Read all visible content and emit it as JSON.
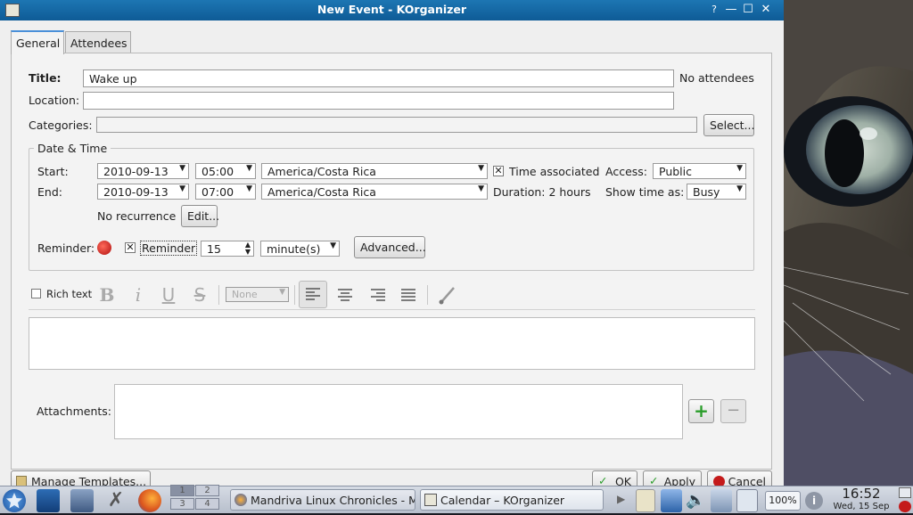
{
  "window": {
    "title": "New Event - KOrganizer",
    "help": "?"
  },
  "tabs": [
    {
      "label": "General"
    },
    {
      "label": "Attendees"
    }
  ],
  "general": {
    "title_label": "Title:",
    "title_value": "Wake up",
    "attendees_note": "No attendees",
    "location_label": "Location:",
    "location_value": "",
    "categories_label": "Categories:",
    "categories_value": "",
    "select_button": "Select...",
    "datetime_group": "Date & Time",
    "start_label": "Start:",
    "start_date": "2010-09-13",
    "start_time": "05:00",
    "start_tz": "America/Costa Rica",
    "time_associated": "Time associated",
    "access_label": "Access:",
    "access_value": "Public",
    "end_label": "End:",
    "end_date": "2010-09-13",
    "end_time": "07:00",
    "end_tz": "America/Costa Rica",
    "duration": "Duration: 2 hours",
    "show_time_label": "Show time as:",
    "show_time_value": "Busy",
    "recurrence": "No recurrence",
    "edit_button": "Edit...",
    "reminder_label": "Reminder:",
    "reminder_check_label": "Reminder",
    "reminder_value": "15",
    "reminder_unit": "minute(s)",
    "advanced_button": "Advanced...",
    "rich_text_label": "Rich text",
    "font_size_value": "None",
    "description": "",
    "attachments_label": "Attachments:"
  },
  "bottom_buttons": {
    "templates": "Manage Templates...",
    "ok": "OK",
    "apply": "Apply",
    "cancel": "Cancel"
  },
  "taskbar": {
    "pager": [
      "1",
      "2",
      "3",
      "4"
    ],
    "tasks": [
      {
        "label": "Mandriva Linux Chronicles - M"
      },
      {
        "label": "Calendar – KOrganizer"
      }
    ],
    "battery": "100%",
    "clock_time": "16:52",
    "clock_date": "Wed, 15 Sep"
  }
}
